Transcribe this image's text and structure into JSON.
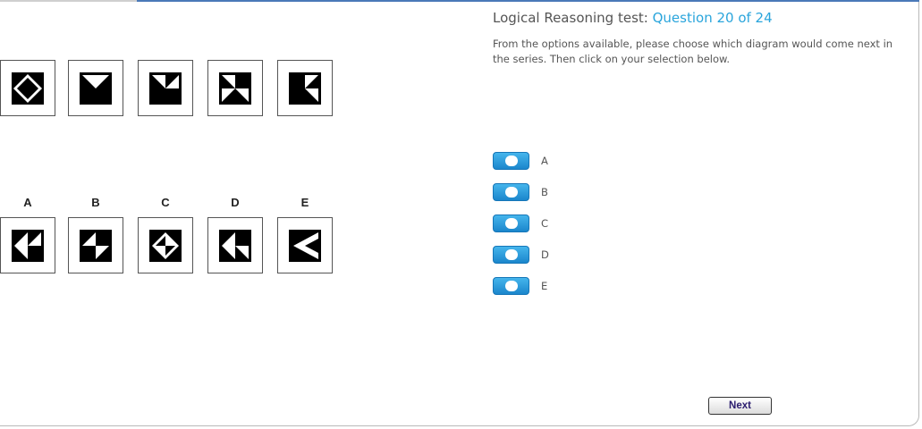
{
  "header": {
    "title_prefix": "Logical Reasoning test:",
    "question_counter": "Question 20 of 24",
    "instructions": "From the options available, please choose which diagram would come next in the series. Then click on your selection below."
  },
  "series": [
    {
      "icon": "diamond-in-square-icon"
    },
    {
      "icon": "triangles-pattern-icon-2"
    },
    {
      "icon": "triangles-pattern-icon-3"
    },
    {
      "icon": "bowtie-pattern-icon"
    },
    {
      "icon": "left-arrow-triangles-icon"
    }
  ],
  "answers": [
    {
      "letter": "A",
      "icon": "answer-a-pattern-icon"
    },
    {
      "letter": "B",
      "icon": "answer-b-pattern-icon"
    },
    {
      "letter": "C",
      "icon": "answer-c-pattern-icon"
    },
    {
      "letter": "D",
      "icon": "answer-d-pattern-icon"
    },
    {
      "letter": "E",
      "icon": "answer-e-pattern-icon"
    }
  ],
  "options": [
    {
      "label": "A"
    },
    {
      "label": "B"
    },
    {
      "label": "C"
    },
    {
      "label": "D"
    },
    {
      "label": "E"
    }
  ],
  "next_label": "Next",
  "colors": {
    "accent_blue": "#2aa5dc",
    "radio_blue": "#1b86cc",
    "text_gray": "#555555",
    "top_border_blue": "#4a79b8"
  }
}
